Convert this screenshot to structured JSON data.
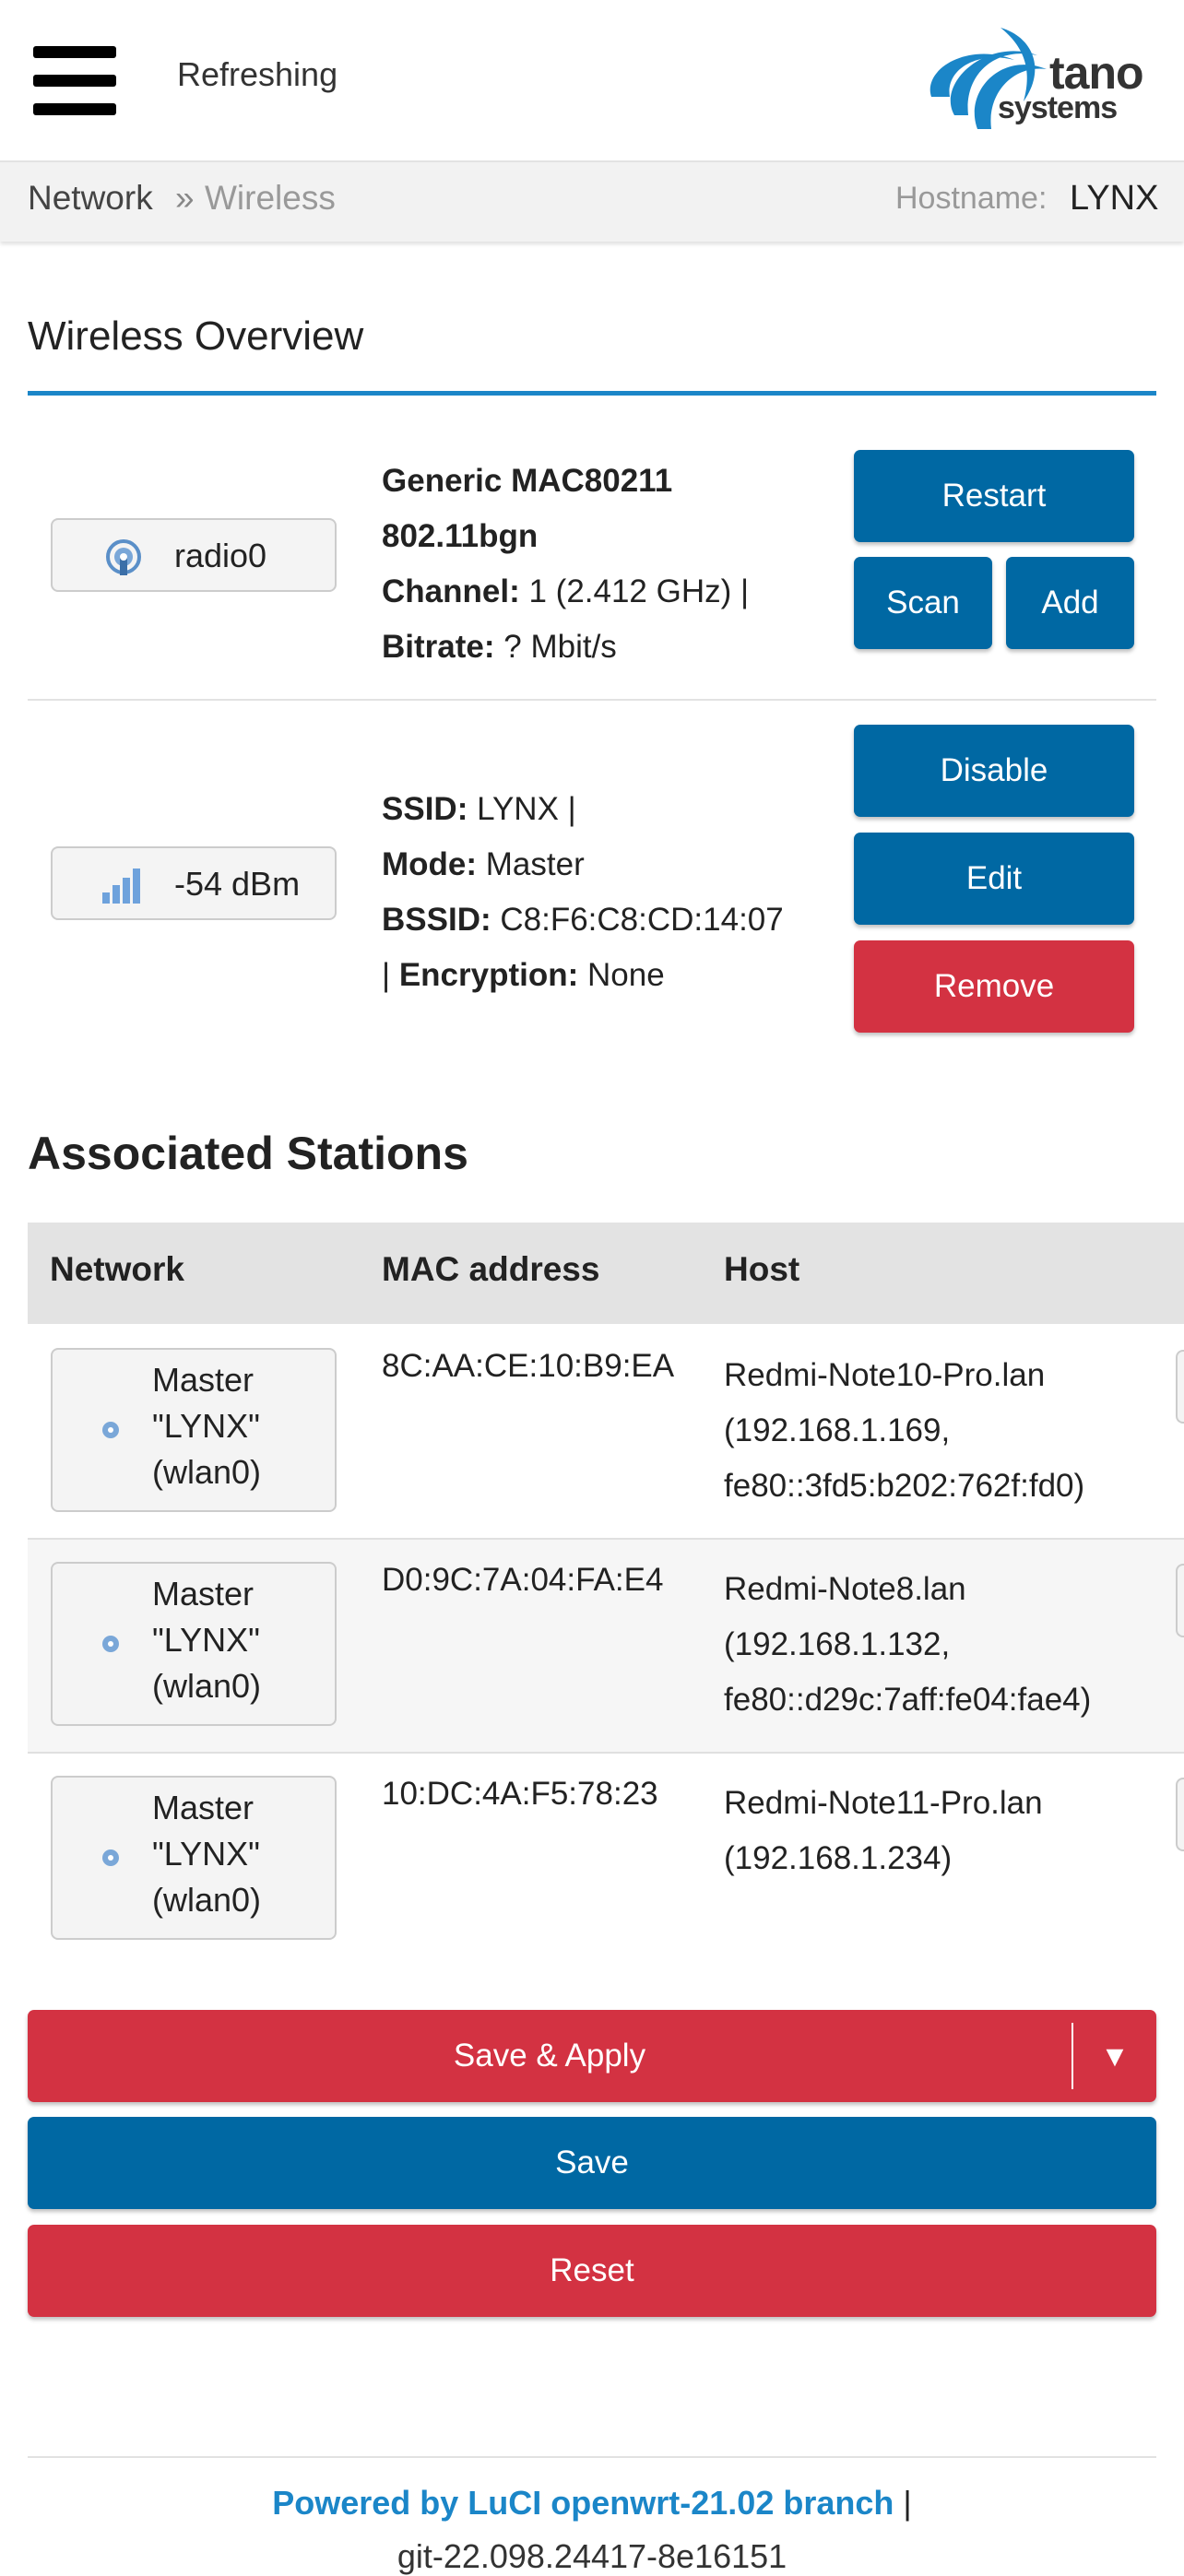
{
  "header": {
    "status": "Refreshing",
    "logo_word1": "tano",
    "logo_word2": "systems"
  },
  "breadcrumb": {
    "items": [
      "Network",
      "Wireless"
    ],
    "separator": "»",
    "hostname_label": "Hostname:",
    "hostname_value": "LYNX"
  },
  "overview": {
    "title": "Wireless Overview",
    "radio": {
      "badge_label": "radio0",
      "line1": "Generic MAC80211",
      "line2": "802.11bgn",
      "channel_label": "Channel:",
      "channel_value": "1 (2.412 GHz) |",
      "bitrate_label": "Bitrate:",
      "bitrate_value": "? Mbit/s",
      "buttons": {
        "restart": "Restart",
        "scan": "Scan",
        "add": "Add"
      }
    },
    "network": {
      "badge_label": "-54 dBm",
      "ssid_label": "SSID:",
      "ssid_value": "LYNX |",
      "mode_label": "Mode:",
      "mode_value": "Master",
      "bssid_label": "BSSID:",
      "bssid_value": "C8:F6:C8:CD:14:07",
      "enc_prefix": "|",
      "encryption_label": "Encryption:",
      "encryption_value": "None",
      "buttons": {
        "disable": "Disable",
        "edit": "Edit",
        "remove": "Remove"
      }
    }
  },
  "stations": {
    "title": "Associated Stations",
    "columns": [
      "Network",
      "MAC address",
      "Host"
    ],
    "rows": [
      {
        "network_mode": "Master",
        "network_ssid": "\"LYNX\"",
        "network_iface": "(wlan0)",
        "mac": "8C:AA:CE:10:B9:EA",
        "host_line1": "Redmi-Note10-Pro.lan",
        "host_line2": "(192.168.1.169,",
        "host_line3": "fe80::3fd5:b202:762f:fd0)"
      },
      {
        "network_mode": "Master",
        "network_ssid": "\"LYNX\"",
        "network_iface": "(wlan0)",
        "mac": "D0:9C:7A:04:FA:E4",
        "host_line1": "Redmi-Note8.lan",
        "host_line2": "(192.168.1.132,",
        "host_line3": "fe80::d29c:7aff:fe04:fae4)"
      },
      {
        "network_mode": "Master",
        "network_ssid": "\"LYNX\"",
        "network_iface": "(wlan0)",
        "mac": "10:DC:4A:F5:78:23",
        "host_line1": "Redmi-Note11-Pro.lan",
        "host_line2": "(192.168.1.234)",
        "host_line3": ""
      }
    ]
  },
  "actions": {
    "save_apply": "Save & Apply",
    "dropdown_glyph": "▼",
    "save": "Save",
    "reset": "Reset"
  },
  "footer": {
    "powered": "Powered by LuCI openwrt-21.02 branch",
    "separator": "|",
    "version": "git-22.098.24417-8e16151"
  },
  "colors": {
    "primary": "#0068a3",
    "danger": "#d33242",
    "accent": "#1b86c8"
  }
}
